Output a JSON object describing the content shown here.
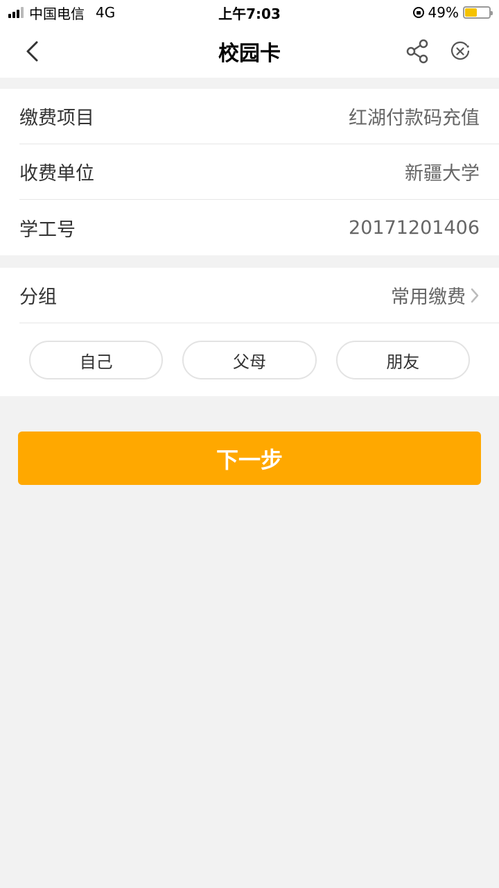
{
  "status_bar": {
    "carrier": "中国电信",
    "network": "4G",
    "time": "上午7:03",
    "battery": "49%",
    "battery_level": 0.49
  },
  "nav": {
    "title": "校园卡",
    "back_icon": "chevron-left-icon",
    "share_icon": "share-icon",
    "close_icon": "close-circle-icon"
  },
  "info": {
    "rows": [
      {
        "label": "缴费项目",
        "value": "红湖付款码充值"
      },
      {
        "label": "收费单位",
        "value": "新疆大学"
      },
      {
        "label": "学工号",
        "value": "20171201406"
      }
    ]
  },
  "group": {
    "label": "分组",
    "value": "常用缴费",
    "chips": [
      "自己",
      "父母",
      "朋友"
    ]
  },
  "next_button": "下一步",
  "colors": {
    "accent": "#ffa800",
    "background": "#f2f2f2"
  }
}
